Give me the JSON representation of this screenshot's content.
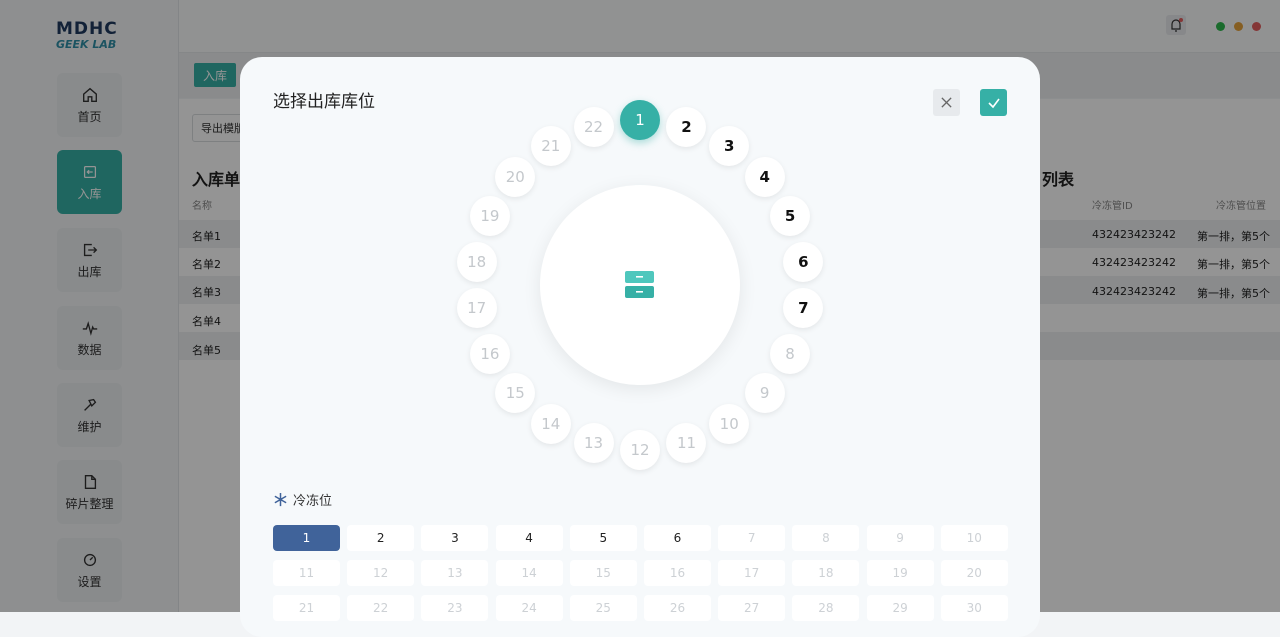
{
  "app": {
    "logo_top": "MDHC",
    "logo_bottom": "GEEK LAB"
  },
  "sidebar": {
    "items": [
      {
        "label": "首页",
        "icon": "home-icon",
        "active": false
      },
      {
        "label": "入库",
        "icon": "inbound-icon",
        "active": true
      },
      {
        "label": "出库",
        "icon": "outbound-icon",
        "active": false
      },
      {
        "label": "数据",
        "icon": "pulse-icon",
        "active": false
      },
      {
        "label": "维护",
        "icon": "hammer-icon",
        "active": false
      },
      {
        "label": "碎片整理",
        "icon": "document-icon",
        "active": false
      },
      {
        "label": "设置",
        "icon": "settings-icon",
        "active": false
      }
    ]
  },
  "window_controls": {
    "colors": [
      "#2db84d",
      "#e6a23c",
      "#e35d5d"
    ]
  },
  "tabs": [
    {
      "label": "入库"
    }
  ],
  "toolbar": {
    "export_label": "导出模版"
  },
  "left_list": {
    "title": "入库单",
    "column_name": "名称",
    "rows": [
      "名单1",
      "名单2",
      "名单3",
      "名单4",
      "名单5"
    ]
  },
  "right_list": {
    "title": "列表",
    "col_id": "冷冻管ID",
    "col_pos": "冷冻管位置",
    "rows": [
      {
        "id": "432423423242",
        "pos": "第一排，第5个"
      },
      {
        "id": "432423423242",
        "pos": "第一排，第5个"
      },
      {
        "id": "432423423242",
        "pos": "第一排，第5个"
      }
    ]
  },
  "modal": {
    "title": "选择出库库位",
    "close_icon": "close-icon",
    "confirm_icon": "check-icon",
    "hub_icon": "drawer-icon",
    "dial": {
      "slots": [
        "1",
        "2",
        "3",
        "4",
        "5",
        "6",
        "7",
        "8",
        "9",
        "10",
        "11",
        "12",
        "13",
        "14",
        "15",
        "16",
        "17",
        "18",
        "19",
        "20",
        "21",
        "22"
      ],
      "selected": "1",
      "available": [
        "2",
        "3",
        "4",
        "5",
        "6",
        "7"
      ]
    },
    "freeze": {
      "label": "冷冻位",
      "icon": "snowflake-icon",
      "positions": [
        "1",
        "2",
        "3",
        "4",
        "5",
        "6",
        "7",
        "8",
        "9",
        "10",
        "11",
        "12",
        "13",
        "14",
        "15",
        "16",
        "17",
        "18",
        "19",
        "20",
        "21",
        "22",
        "23",
        "24",
        "25",
        "26",
        "27",
        "28",
        "29",
        "30"
      ],
      "selected": "1",
      "available": [
        "2",
        "3",
        "4",
        "5",
        "6"
      ]
    }
  },
  "colors": {
    "accent": "#36b0a6",
    "selected_grid": "#40639a"
  }
}
